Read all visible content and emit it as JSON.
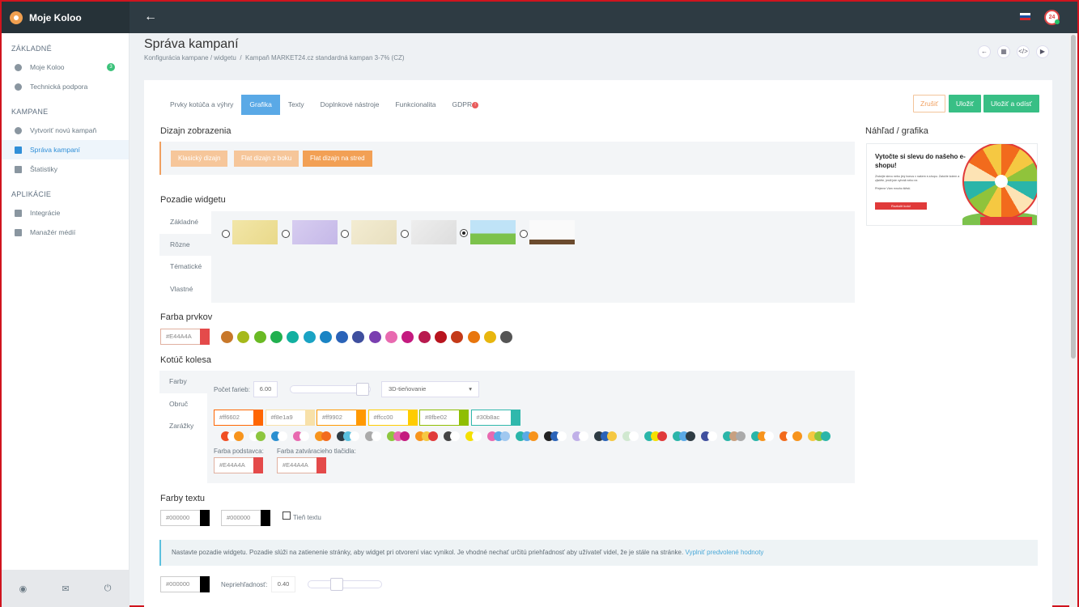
{
  "app": {
    "title": "Moje Koloo",
    "avatar_text": "24"
  },
  "sidebar": {
    "sections": [
      {
        "title": "ZÁKLADNÉ",
        "items": [
          {
            "label": "Moje Koloo",
            "badge": "3"
          },
          {
            "label": "Technická podpora"
          }
        ]
      },
      {
        "title": "KAMPANE",
        "items": [
          {
            "label": "Vytvoriť novú kampaň"
          },
          {
            "label": "Správa kampaní"
          },
          {
            "label": "Štatistiky"
          }
        ]
      },
      {
        "title": "APLIKÁCIE",
        "items": [
          {
            "label": "Integrácie"
          },
          {
            "label": "Manažér médií"
          }
        ]
      }
    ]
  },
  "page": {
    "title": "Správa kampaní",
    "breadcrumb_1": "Konfigurácia kampane / widgetu",
    "breadcrumb_sep": "/",
    "breadcrumb_2": "Kampaň MARKET24.cz standardná kampan 3-7% (CZ)"
  },
  "tabs": [
    "Prvky kotúča a výhry",
    "Grafika",
    "Texty",
    "Doplnkové nástroje",
    "Funkcionalita",
    "GDPR"
  ],
  "gdpr_badge": "!",
  "buttons": {
    "cancel": "Zrušiť",
    "save": "Uložiť",
    "save_leave": "Uložiť a odísť"
  },
  "design": {
    "title": "Dizajn zobrazenia",
    "options": [
      "Klasický dizajn",
      "Flat dizajn z boku",
      "Flat dizajn na stred"
    ]
  },
  "background": {
    "title": "Pozadie widgetu",
    "tabs": [
      "Základné",
      "Rôzne",
      "Tématické",
      "Vlastné"
    ]
  },
  "element_color": {
    "title": "Farba prvkov",
    "value": "#E44A4A"
  },
  "palette": [
    "#c8782a",
    "#a6b91a",
    "#6aba24",
    "#21b04f",
    "#12b0a0",
    "#1aa3c4",
    "#1a84c4",
    "#2a63b8",
    "#3f4f9e",
    "#7a3fb0",
    "#e86ab0",
    "#c41a7f",
    "#b81a4f",
    "#b8141e",
    "#c43a18",
    "#e8760e",
    "#e8b60e",
    "#555555"
  ],
  "wheel": {
    "title": "Kotúč kolesa",
    "tabs": [
      "Farby",
      "Obruč",
      "Zarážky"
    ],
    "count_label": "Počet farieb:",
    "count_value": "6.00",
    "shading": "3D-tieňovanie",
    "colors": [
      "#ff6602",
      "#f8e1a9",
      "#ff9902",
      "#ffcc00",
      "#8fbe02",
      "#30b8ac"
    ],
    "stand_label": "Farba podstavca:",
    "stand_value": "#E44A4A",
    "close_label": "Farba zatváracieho tlačidla:",
    "close_value": "#E44A4A"
  },
  "text_colors": {
    "title": "Farby textu",
    "color1": "#000000",
    "color2": "#000000",
    "shadow_label": "Tieň textu"
  },
  "info": {
    "text": "Nastavte pozadie widgetu. Pozadie slúži na zatienenie stránky, aby widget pri otvorení viac vynikol. Je vhodné nechať určitú priehľadnosť aby užívateľ videl, že je stále na stránke.",
    "link": "Vyplniť predvolené hodnoty"
  },
  "overlay": {
    "color": "#000000",
    "opacity_label": "Nepriehľadnosť:",
    "opacity_value": "0.40"
  },
  "preview": {
    "title": "Náhľad / grafika",
    "headline": "Vytočte si slevu do našeho e-shopu!",
    "body": "Získejte slevu nebo jiný bonus v našem e-shopu. Zatočte kolem a zjistěte, jestli jste vyhráli nebo ne.",
    "body2": "Přejeme Vám mnoho štěstí.",
    "button": "Roztočit kolo!"
  },
  "colors": {
    "accent": "#5aa9e6",
    "orange": "#f2a055",
    "green": "#38bf85",
    "red": "#e44a4a"
  }
}
